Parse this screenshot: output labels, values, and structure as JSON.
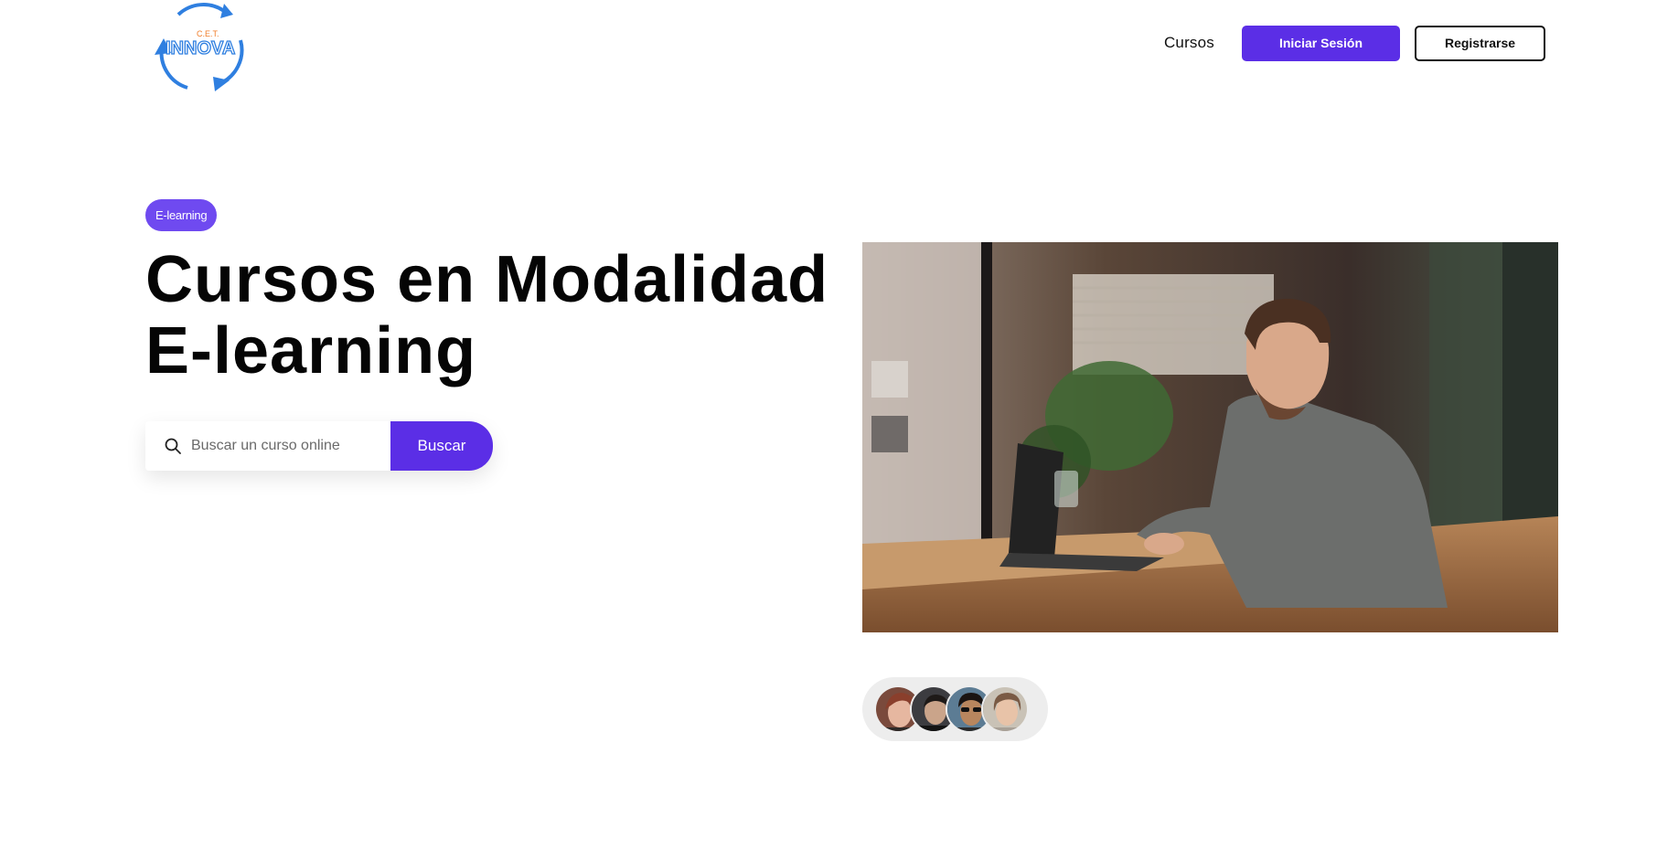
{
  "header": {
    "logo": {
      "top_text": "C.E.T.",
      "main_text": "INNOVA",
      "icon": "recycle-arrows-logo"
    },
    "nav": {
      "courses_link": "Cursos",
      "login_button": "Iniciar Sesión",
      "register_button": "Registrarse"
    }
  },
  "hero": {
    "badge": "E-learning",
    "title_line1": "Cursos en Modalidad",
    "title_line2": "E-learning",
    "search": {
      "placeholder": "Buscar un curso online",
      "value": "",
      "button_label": "Buscar",
      "icon": "search-icon"
    },
    "image": {
      "description_icon": "hero-photo-man-laptop-cafe"
    },
    "avatars": [
      {
        "icon": "avatar-woman-1"
      },
      {
        "icon": "avatar-man-1"
      },
      {
        "icon": "avatar-man-sunglasses"
      },
      {
        "icon": "avatar-woman-2"
      }
    ]
  },
  "colors": {
    "primary": "#5b2ee6",
    "badge": "#6f4af0",
    "text": "#050505",
    "avatar_bg": "#ededed",
    "logo_blue": "#2f7fe0",
    "logo_orange": "#f07d2a"
  }
}
